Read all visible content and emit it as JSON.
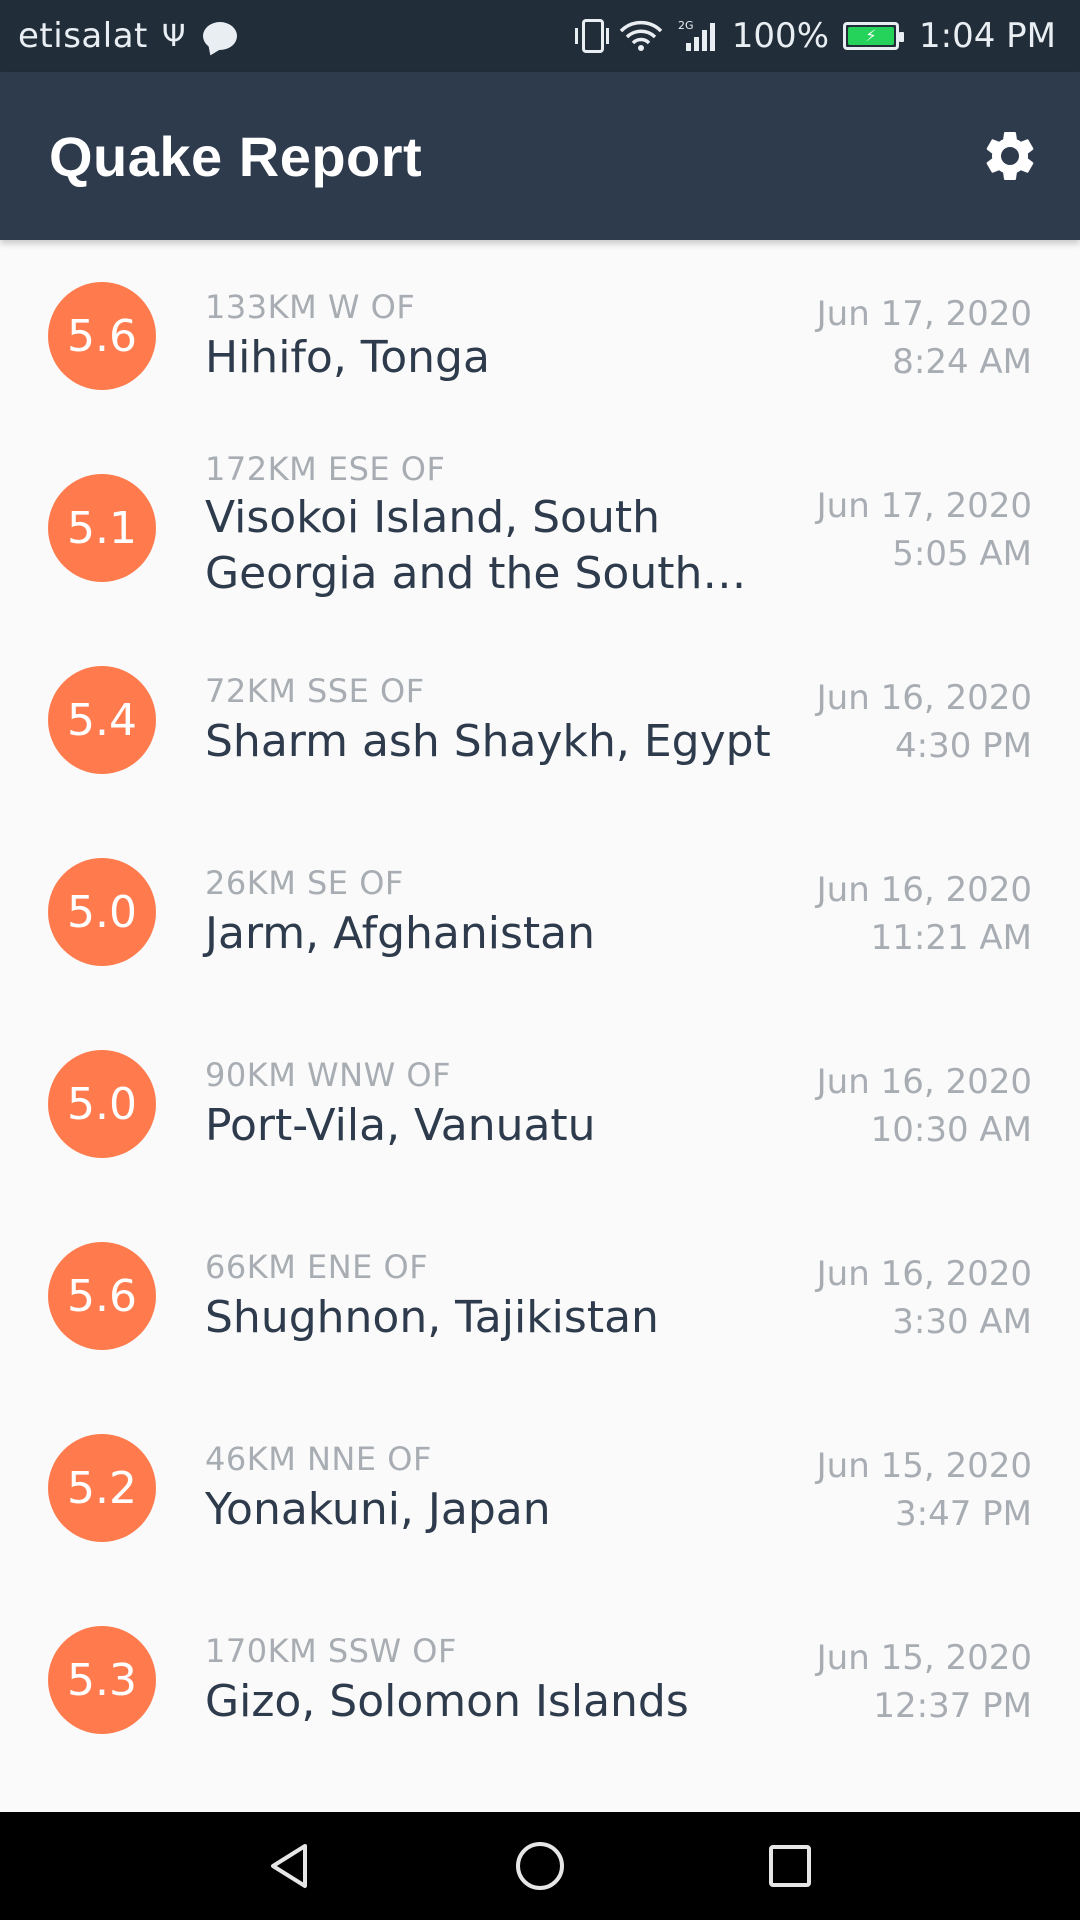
{
  "status_bar": {
    "carrier": "etisalat",
    "network": "2G",
    "battery_percent": "100%",
    "time": "1:04 PM"
  },
  "app_bar": {
    "title": "Quake Report",
    "settings_icon": "gear-icon"
  },
  "quakes": [
    {
      "magnitude": "5.6",
      "offset": "133KM W OF",
      "place": "Hihifo, Tonga",
      "date": "Jun 17, 2020",
      "time": "8:24 AM"
    },
    {
      "magnitude": "5.1",
      "offset": "172KM ESE OF",
      "place": "Visokoi Island, South Georgia and the South Sandwich Isl…",
      "date": "Jun 17, 2020",
      "time": "5:05 AM"
    },
    {
      "magnitude": "5.4",
      "offset": "72KM SSE OF",
      "place": "Sharm ash Shaykh, Egypt",
      "date": "Jun 16, 2020",
      "time": "4:30 PM"
    },
    {
      "magnitude": "5.0",
      "offset": "26KM SE OF",
      "place": "Jarm, Afghanistan",
      "date": "Jun 16, 2020",
      "time": "11:21 AM"
    },
    {
      "magnitude": "5.0",
      "offset": "90KM WNW OF",
      "place": "Port-Vila, Vanuatu",
      "date": "Jun 16, 2020",
      "time": "10:30 AM"
    },
    {
      "magnitude": "5.6",
      "offset": "66KM ENE OF",
      "place": "Shughnon, Tajikistan",
      "date": "Jun 16, 2020",
      "time": "3:30 AM"
    },
    {
      "magnitude": "5.2",
      "offset": "46KM NNE OF",
      "place": "Yonakuni, Japan",
      "date": "Jun 15, 2020",
      "time": "3:47 PM"
    },
    {
      "magnitude": "5.3",
      "offset": "170KM SSW OF",
      "place": "Gizo, Solomon Islands",
      "date": "Jun 15, 2020",
      "time": "12:37 PM"
    }
  ],
  "colors": {
    "status_bar": "#222d3a",
    "app_bar": "#2e3b4c",
    "magnitude_circle": "#ff7a4d",
    "secondary_text": "#a8adb3",
    "primary_text": "#2e3b4c"
  },
  "nav_bar": {
    "back_icon": "back-triangle-icon",
    "home_icon": "home-circle-icon",
    "recents_icon": "recents-square-icon"
  }
}
